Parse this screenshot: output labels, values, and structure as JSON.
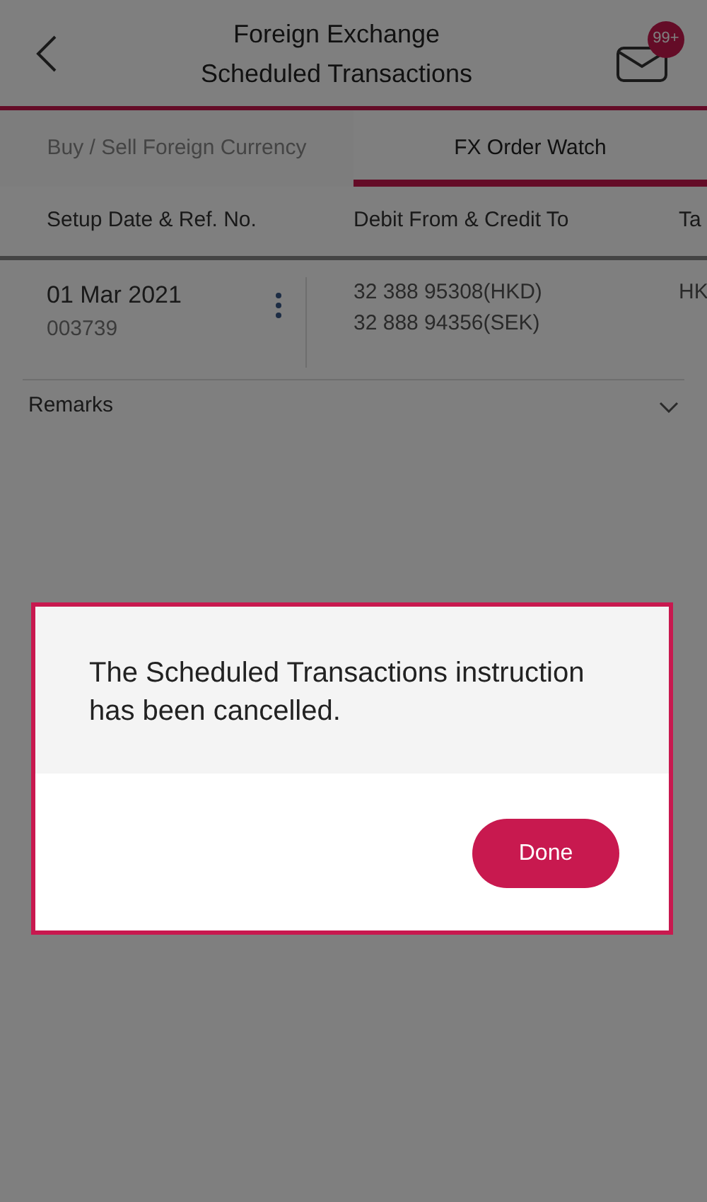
{
  "header": {
    "title": "Foreign Exchange",
    "subtitle": "Scheduled Transactions",
    "badge": "99+"
  },
  "tabs": [
    {
      "label": "Buy / Sell Foreign Currency",
      "selected": false
    },
    {
      "label": "FX Order Watch",
      "selected": true
    }
  ],
  "table": {
    "columns": [
      "Setup Date & Ref. No.",
      "Debit From & Credit To",
      "Ta"
    ],
    "rows": [
      {
        "date": "01 Mar 2021",
        "ref": "003739",
        "accounts": [
          "32 388 95308(HKD)",
          "32 888 94356(SEK)"
        ],
        "column_3": "HK"
      }
    ]
  },
  "remarks": {
    "label": "Remarks",
    "expanded": false
  },
  "dialog": {
    "message": "The Scheduled Transactions instruction has been cancelled.",
    "button": "Done"
  }
}
